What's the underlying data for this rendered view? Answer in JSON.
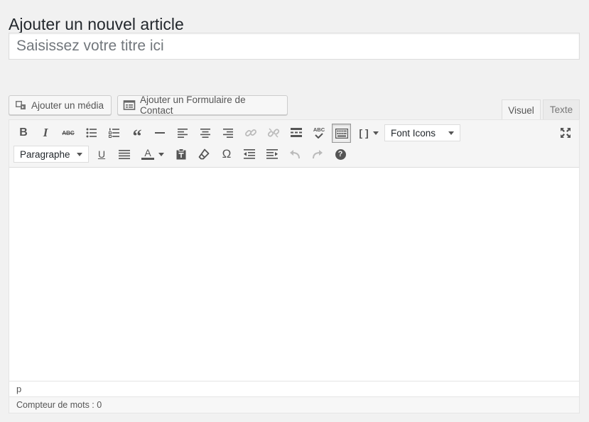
{
  "page": {
    "title": "Ajouter un nouvel article"
  },
  "title_input": {
    "placeholder": "Saisissez votre titre ici",
    "value": ""
  },
  "media_buttons": {
    "add_media": "Ajouter un média",
    "add_form": "Ajouter un Formulaire de Contact"
  },
  "tabs": {
    "visual": "Visuel",
    "text": "Texte",
    "active": "visual"
  },
  "toolbar": {
    "strike_label": "ABC",
    "spell_label": "ABC",
    "shortcode_label": "[ ]",
    "font_icons": "Font Icons",
    "format_select": "Paragraphe",
    "color_label": "A",
    "omega_label": "Ω",
    "underline_label": "U",
    "help_label": "?",
    "text_color": "#555555"
  },
  "editor": {
    "path": "p"
  },
  "status": {
    "word_count": "Compteur de mots : 0"
  }
}
